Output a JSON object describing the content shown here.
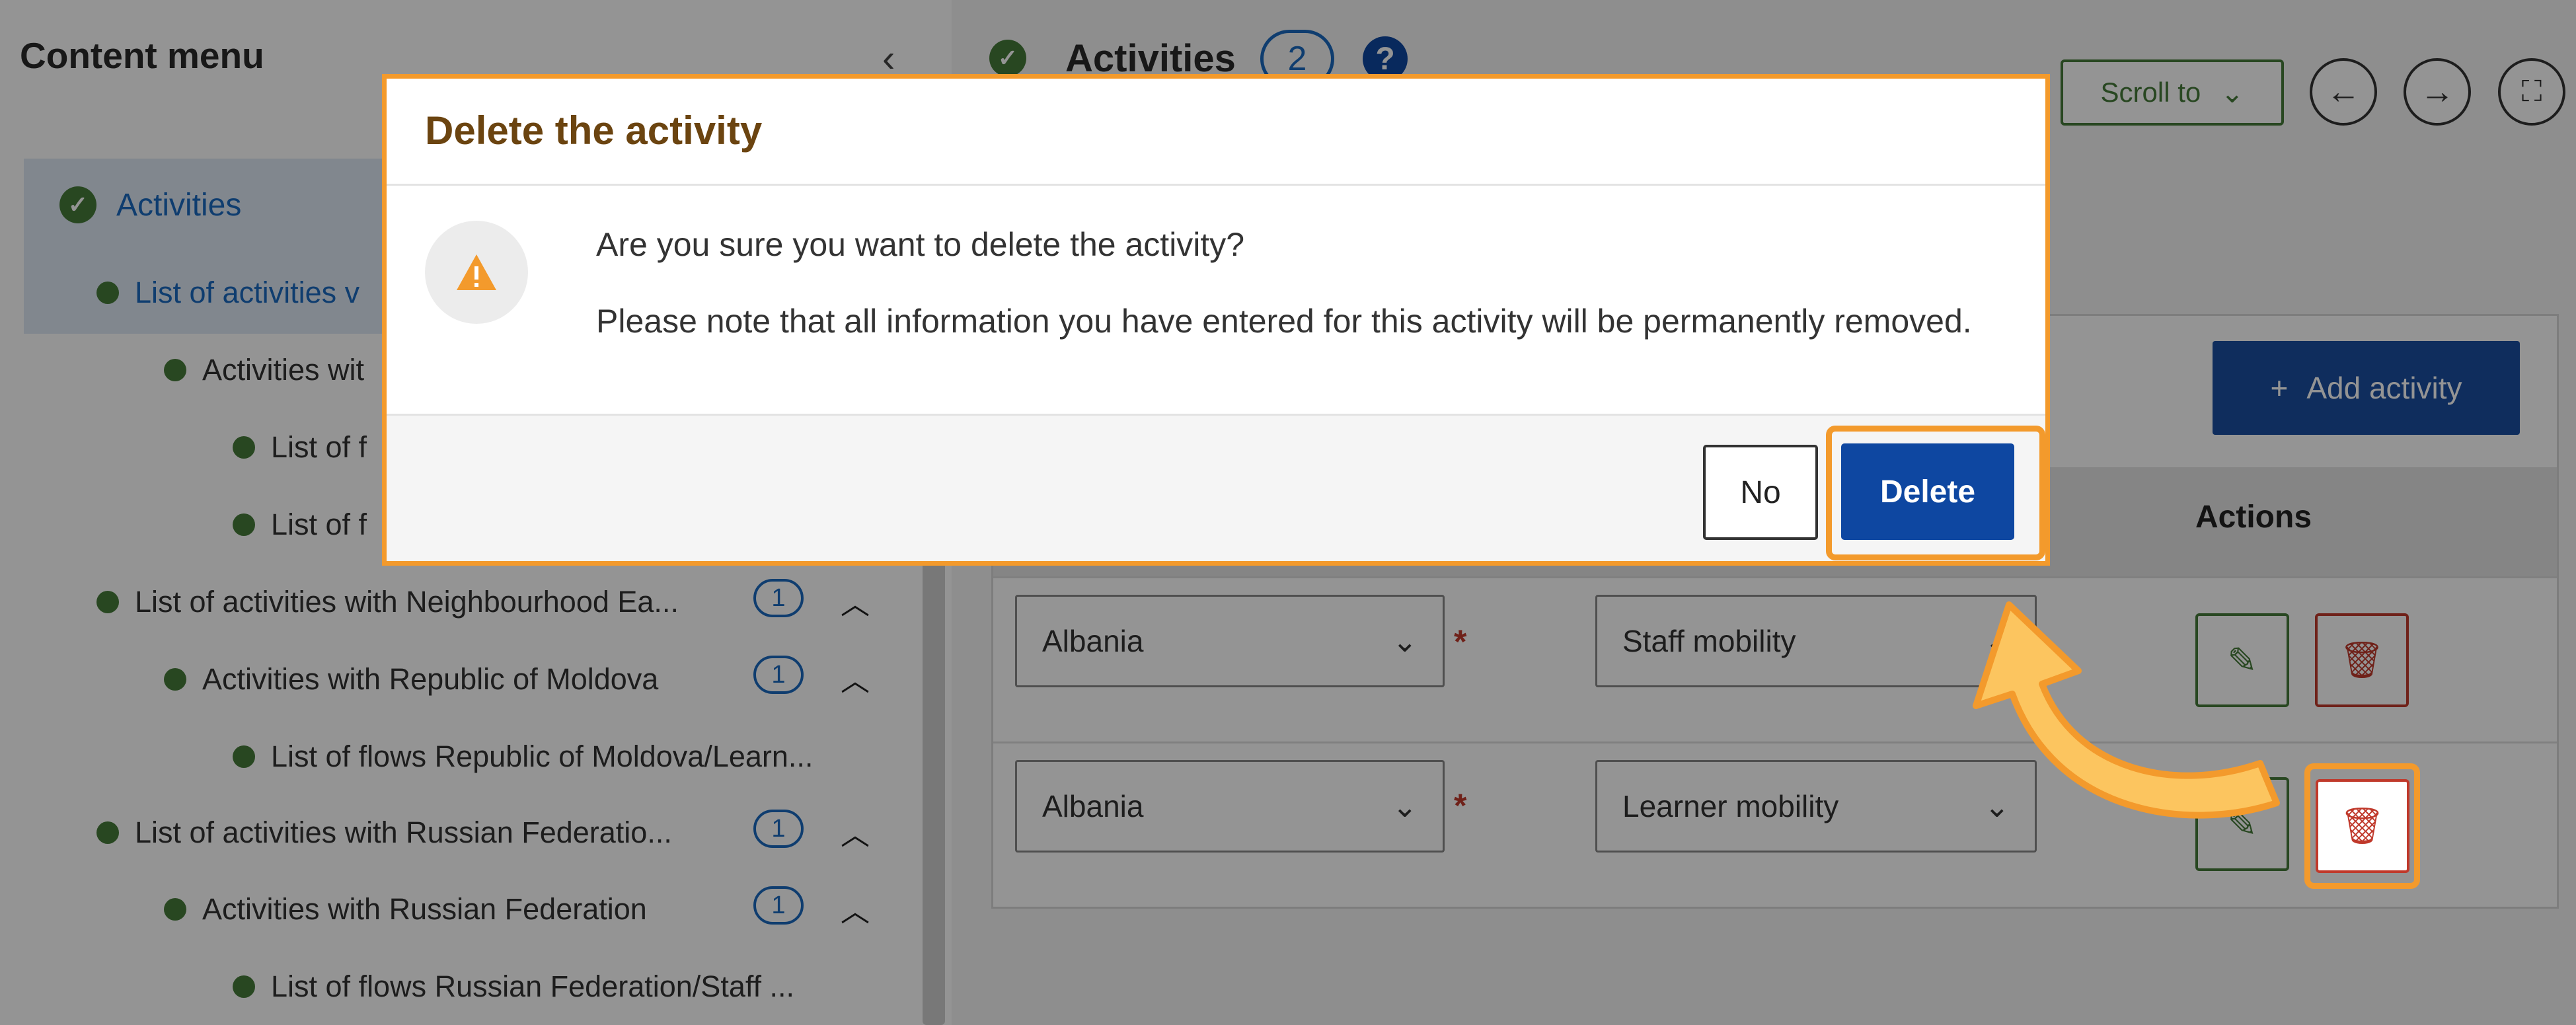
{
  "sidebar": {
    "title": "Content menu",
    "items": [
      {
        "label": "Activities"
      },
      {
        "label": "List of activities v"
      },
      {
        "label": "Activities wit"
      },
      {
        "label": "List of f"
      },
      {
        "label": "List of f"
      },
      {
        "label": "List of activities with Neighbourhood Ea...",
        "count": "1"
      },
      {
        "label": "Activities with Republic of Moldova",
        "count": "1"
      },
      {
        "label": "List of flows Republic of Moldova/Learn..."
      },
      {
        "label": "List of activities with Russian Federatio...",
        "count": "1"
      },
      {
        "label": "Activities with Russian Federation",
        "count": "1"
      },
      {
        "label": "List of flows Russian Federation/Staff ..."
      }
    ]
  },
  "main": {
    "title": "Activities",
    "count": "2",
    "scroll_to": "Scroll to",
    "add_activity": "Add activity",
    "actions_header": "Actions",
    "rows": [
      {
        "country": "Albania",
        "type": "Staff mobility"
      },
      {
        "country": "Albania",
        "type": "Learner mobility"
      }
    ]
  },
  "modal": {
    "title": "Delete the activity",
    "message1": "Are you sure you want to delete the activity?",
    "message2": "Please note that all information you have entered for this activity will be permanently removed.",
    "no_label": "No",
    "delete_label": "Delete"
  },
  "colors": {
    "accent_green": "#467a39",
    "primary_blue": "#0e47a1",
    "highlight_orange": "#f39a2c",
    "danger_red": "#c0392b"
  }
}
